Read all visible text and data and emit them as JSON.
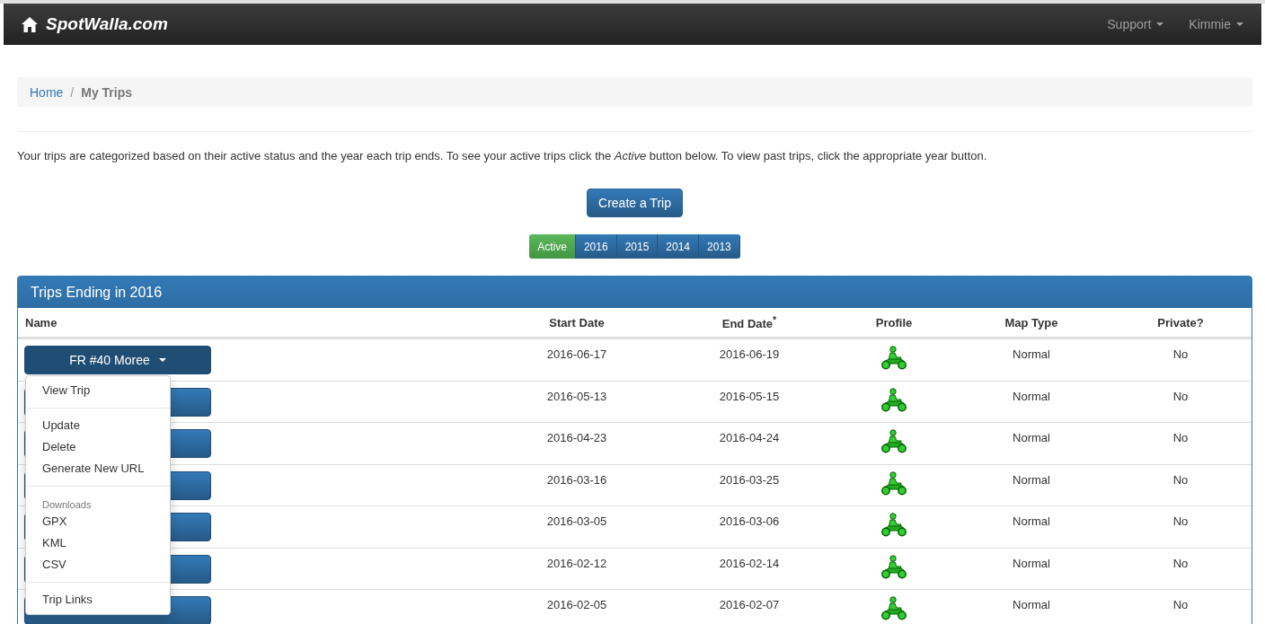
{
  "navbar": {
    "brand": "SpotWalla.com",
    "menus": [
      {
        "label": "Support"
      },
      {
        "label": "Kimmie"
      }
    ]
  },
  "breadcrumb": [
    {
      "label": "Home",
      "kind": "link"
    },
    {
      "label": "/",
      "kind": "separator"
    },
    {
      "label": "My Trips",
      "kind": "current"
    }
  ],
  "intro": "Your trips are categorized based on their active status and the year each trip ends. To see your active trips click the *Active* button below. To view past trips, click the appropriate year button.",
  "create_button": "Create a Trip",
  "year_filters": [
    {
      "label": "Active",
      "selected": true
    },
    {
      "label": "2016",
      "selected": false
    },
    {
      "label": "2015",
      "selected": false
    },
    {
      "label": "2014",
      "selected": false
    },
    {
      "label": "2013",
      "selected": false
    }
  ],
  "panel": {
    "title": "Trips Ending in 2016",
    "columns": [
      "Name",
      "Start Date",
      "End Date$^{*}$",
      "Profile",
      "Map Type",
      "Private?"
    ],
    "rows": [
      {
        "name": "FR #40 Moree",
        "open": true,
        "start": "2016-06-17",
        "end": "2016-06-19",
        "map_type": "Normal",
        "private": "No"
      },
      {
        "open": false,
        "start": "2016-05-13",
        "end": "2016-05-15",
        "map_type": "Normal",
        "private": "No"
      },
      {
        "open": false,
        "start": "2016-04-23",
        "end": "2016-04-24",
        "map_type": "Normal",
        "private": "No"
      },
      {
        "open": false,
        "start": "2016-03-16",
        "end": "2016-03-25",
        "map_type": "Normal",
        "private": "No"
      },
      {
        "open": false,
        "start": "2016-03-05",
        "end": "2016-03-06",
        "map_type": "Normal",
        "private": "No"
      },
      {
        "open": false,
        "start": "2016-02-12",
        "end": "2016-02-14",
        "map_type": "Normal",
        "private": "No"
      },
      {
        "open": false,
        "start": "2016-02-05",
        "end": "2016-02-07",
        "map_type": "Normal",
        "private": "No"
      }
    ]
  },
  "dropdown_menu": [
    {
      "kind": "item",
      "label": "View Trip"
    },
    {
      "kind": "divider"
    },
    {
      "kind": "item",
      "label": "Update"
    },
    {
      "kind": "item",
      "label": "Delete"
    },
    {
      "kind": "item",
      "label": "Generate New URL"
    },
    {
      "kind": "divider"
    },
    {
      "kind": "header",
      "label": "Downloads"
    },
    {
      "kind": "item",
      "label": "GPX"
    },
    {
      "kind": "item",
      "label": "KML"
    },
    {
      "kind": "item",
      "label": "CSV"
    },
    {
      "kind": "divider"
    },
    {
      "kind": "item",
      "label": "Trip Links"
    }
  ]
}
